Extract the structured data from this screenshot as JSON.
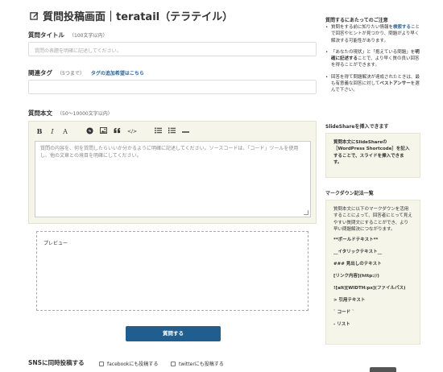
{
  "page": {
    "title": "質問投稿画面｜teratail（テラテイル）"
  },
  "form": {
    "title_label": "質問タイトル",
    "title_note": "（100文字以内）",
    "title_placeholder": "質問の表題を明確に記述してください。",
    "tags_label": "関連タグ",
    "tags_note": "（5つまで）",
    "tags_link": "タグの追加希望はこちら",
    "body_label": "質問本文",
    "body_note": "（50〜10000文字以内）",
    "body_placeholder": "質問の内容を、何を質問したらいいか分かるように明確に記述してください。ソースコードは、「コード」ツールを使用し、他の文章との境目を明確にしてください。",
    "preview_label": "プレビュー",
    "submit_label": "質問する",
    "sns_label": "SNSに同時投稿する",
    "facebook_label": "facebookにも投稿する",
    "twitter_label": "twitterにも投稿する"
  },
  "toolbar": {
    "bold": "B",
    "italic": "I",
    "heading": "A",
    "code": "</>"
  },
  "sidebar": {
    "tips_title": "質問するにあたってのご注意",
    "tip1_a": "質問をする前に知りたい情報を",
    "tip1_link": "検索する",
    "tip1_b": "ことで回答やヒントが見つかり、問題がより早く解決する可能性があります。",
    "tip2_a": "「あなたの現状」と「抱えている問題」を",
    "tip2_bold": "明確に記述する",
    "tip2_b": "ことで、より早く質の良い回答を得ることができます。",
    "tip3_a": "回答を得て問題解決が達成されたときは、最も有意義な回答に対して",
    "tip3_bold": "ベストアンサー",
    "tip3_b": "を選んで下さい。",
    "slideshare_title": "SlideShareを挿入できます",
    "slideshare_text": "質問本文にSlideShareの［WordPress Shortcode］を記入することで、スライドを挿入できます。",
    "markdown_title": "マークダウン記法一覧",
    "markdown_intro": "質問本文に以下のマークダウンを活用することによって、回答者にとって見えやすい質問文にすることができ、より早い問題解決につながります。",
    "markdown_items": [
      "**ボールドテキスト**",
      "__イタリックテキスト__",
      "### 見出しのテキスト",
      "[リンク内容](http://)",
      "![alt][WIDTH:px](ファイルパス)",
      "> 引用テキスト",
      "` コード `",
      "- リスト"
    ]
  }
}
